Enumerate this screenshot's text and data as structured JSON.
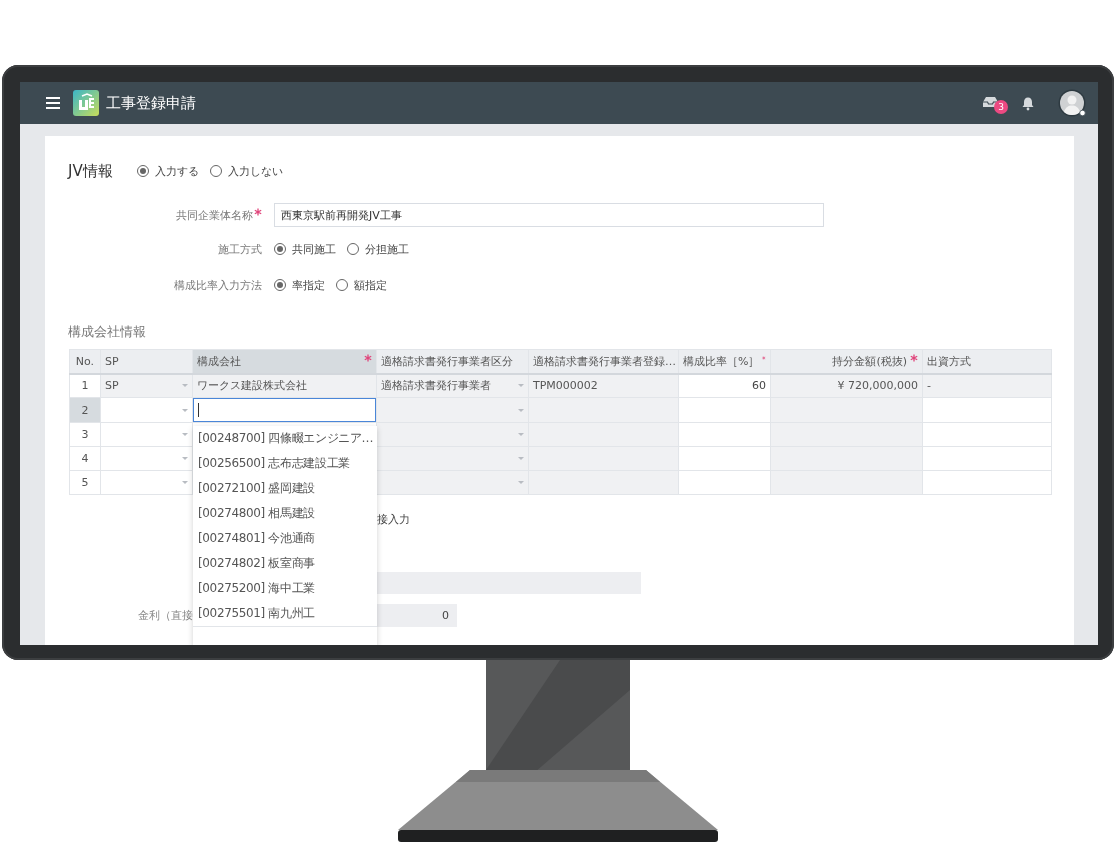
{
  "header": {
    "title": "工事登録申請",
    "notification_count": "3"
  },
  "jv": {
    "title": "JV情報",
    "options": [
      {
        "label": "入力する",
        "selected": true
      },
      {
        "label": "入力しない",
        "selected": false
      }
    ]
  },
  "fields": [
    {
      "kind": "text",
      "label": "共同企業体名称",
      "required": true,
      "value": "西東京駅前再開発JV工事"
    },
    {
      "kind": "radio",
      "label": "施工方式",
      "options": [
        {
          "label": "共同施工",
          "selected": true
        },
        {
          "label": "分担施工",
          "selected": false
        }
      ]
    },
    {
      "kind": "radio",
      "label": "構成比率入力方法",
      "options": [
        {
          "label": "率指定",
          "selected": true
        },
        {
          "label": "額指定",
          "selected": false
        }
      ]
    }
  ],
  "members": {
    "title": "構成会社情報",
    "columns": [
      {
        "label": "No.",
        "kind": "index"
      },
      {
        "label": "SP",
        "kind": "select"
      },
      {
        "label": "構成会社",
        "kind": "text",
        "required": true,
        "highlighted": true
      },
      {
        "label": "適格請求書発行事業者区分",
        "kind": "select"
      },
      {
        "label": "適格請求書発行事業者登録…",
        "kind": "text"
      },
      {
        "label": "構成比率［%］",
        "kind": "number",
        "required": true
      },
      {
        "label": "持分金額(税抜)",
        "kind": "number",
        "required": true
      },
      {
        "label": "出資方式",
        "kind": "text"
      }
    ],
    "rows": [
      {
        "selected": false,
        "cells": [
          {
            "text": "1"
          },
          {
            "text": "SP",
            "readonly": true
          },
          {
            "text": "ワークス建設株式会社",
            "readonly": true
          },
          {
            "text": "適格請求書発行事業者",
            "readonly": true
          },
          {
            "text": "TPM000002",
            "readonly": true
          },
          {
            "text": "60",
            "readonly": false
          },
          {
            "text": "¥ 720,000,000",
            "readonly": true
          },
          {
            "text": "-",
            "readonly": true
          }
        ]
      },
      {
        "selected": true,
        "cells": [
          {
            "text": "2"
          },
          {
            "readonly": false
          },
          {
            "readonly": false,
            "focused": true
          },
          {
            "readonly": true
          },
          {
            "readonly": true
          },
          {
            "readonly": false
          },
          {
            "readonly": true
          },
          {
            "readonly": false
          }
        ]
      },
      {
        "selected": false,
        "cells": [
          {
            "text": "3"
          },
          {
            "readonly": false
          },
          {
            "readonly": false
          },
          {
            "readonly": true
          },
          {
            "readonly": true
          },
          {
            "readonly": false
          },
          {
            "readonly": true
          },
          {
            "readonly": false
          }
        ]
      },
      {
        "selected": false,
        "cells": [
          {
            "text": "4"
          },
          {
            "readonly": false
          },
          {},
          {
            "readonly": true
          },
          {
            "readonly": true
          },
          {
            "readonly": false
          },
          {
            "readonly": true
          },
          {
            "readonly": false
          }
        ]
      },
      {
        "selected": false,
        "cells": [
          {
            "text": "5"
          },
          {
            "readonly": false
          },
          {},
          {
            "readonly": true
          },
          {
            "readonly": true
          },
          {
            "readonly": false
          },
          {
            "readonly": true
          },
          {
            "readonly": false
          }
        ]
      }
    ]
  },
  "lower": {
    "method_text": "接入力",
    "interest": {
      "label": "金利（直接",
      "value": "0"
    }
  },
  "dropdown": {
    "items": [
      "[00248700] 四條畷エンジニア…",
      "[00256500] 志布志建設工業",
      "[00272100] 盛岡建設",
      "[00274800] 相馬建設",
      "[00274801] 今池通商",
      "[00274802] 板室商事",
      "[00275200] 海中工業",
      "[00275501] 南九州工"
    ]
  }
}
